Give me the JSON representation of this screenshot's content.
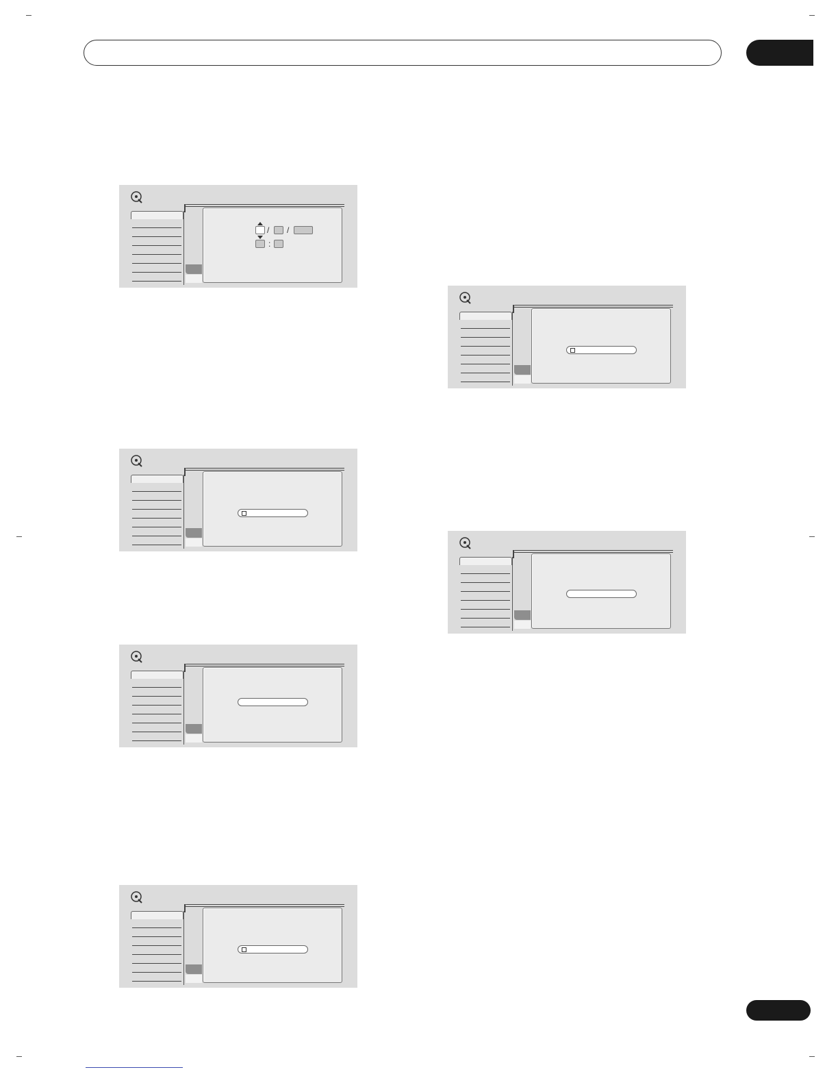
{
  "document": {
    "header_pill_label": "",
    "chapter_label": "",
    "page_number": ""
  },
  "colors": {
    "screen_bg": "#dcdcdc",
    "panel_bg": "#ebebeb",
    "selected_tab": "#8e8e8e",
    "tab_black": "#1a1a1a"
  },
  "icons": {
    "screen_icon": "disc-settings-icon",
    "field_marker": "checkbox-icon",
    "spin_up": "arrow-up-icon",
    "spin_down": "arrow-down-icon"
  },
  "screens": [
    {
      "id": "date-time-screen",
      "content": "date-time-entry",
      "date_separators": [
        "/",
        "/"
      ],
      "time_separator": ":"
    },
    {
      "id": "field-screen-1",
      "content": "checkbox-field"
    },
    {
      "id": "field-screen-2",
      "content": "empty-field"
    },
    {
      "id": "field-screen-3",
      "content": "checkbox-field"
    },
    {
      "id": "field-screen-4",
      "content": "checkbox-field"
    },
    {
      "id": "field-screen-5",
      "content": "empty-field"
    }
  ]
}
